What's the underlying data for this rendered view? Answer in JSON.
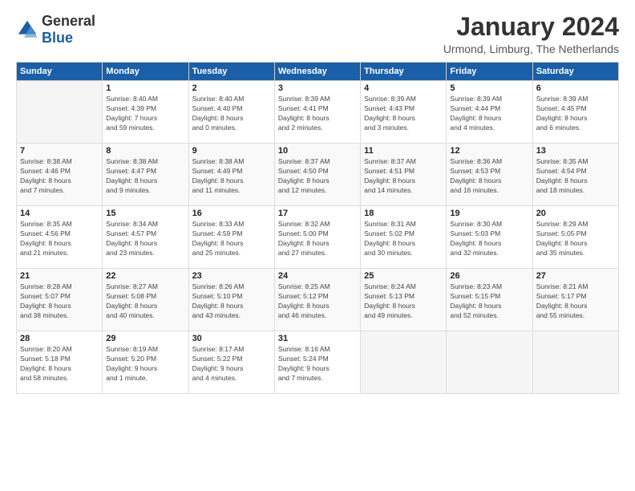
{
  "logo": {
    "general": "General",
    "blue": "Blue"
  },
  "header": {
    "title": "January 2024",
    "location": "Urmond, Limburg, The Netherlands"
  },
  "days_of_week": [
    "Sunday",
    "Monday",
    "Tuesday",
    "Wednesday",
    "Thursday",
    "Friday",
    "Saturday"
  ],
  "weeks": [
    [
      {
        "day": "",
        "info": ""
      },
      {
        "day": "1",
        "info": "Sunrise: 8:40 AM\nSunset: 4:39 PM\nDaylight: 7 hours\nand 59 minutes."
      },
      {
        "day": "2",
        "info": "Sunrise: 8:40 AM\nSunset: 4:40 PM\nDaylight: 8 hours\nand 0 minutes."
      },
      {
        "day": "3",
        "info": "Sunrise: 8:39 AM\nSunset: 4:41 PM\nDaylight: 8 hours\nand 2 minutes."
      },
      {
        "day": "4",
        "info": "Sunrise: 8:39 AM\nSunset: 4:43 PM\nDaylight: 8 hours\nand 3 minutes."
      },
      {
        "day": "5",
        "info": "Sunrise: 8:39 AM\nSunset: 4:44 PM\nDaylight: 8 hours\nand 4 minutes."
      },
      {
        "day": "6",
        "info": "Sunrise: 8:39 AM\nSunset: 4:45 PM\nDaylight: 8 hours\nand 6 minutes."
      }
    ],
    [
      {
        "day": "7",
        "info": "Sunrise: 8:38 AM\nSunset: 4:46 PM\nDaylight: 8 hours\nand 7 minutes."
      },
      {
        "day": "8",
        "info": "Sunrise: 8:38 AM\nSunset: 4:47 PM\nDaylight: 8 hours\nand 9 minutes."
      },
      {
        "day": "9",
        "info": "Sunrise: 8:38 AM\nSunset: 4:49 PM\nDaylight: 8 hours\nand 11 minutes."
      },
      {
        "day": "10",
        "info": "Sunrise: 8:37 AM\nSunset: 4:50 PM\nDaylight: 8 hours\nand 12 minutes."
      },
      {
        "day": "11",
        "info": "Sunrise: 8:37 AM\nSunset: 4:51 PM\nDaylight: 8 hours\nand 14 minutes."
      },
      {
        "day": "12",
        "info": "Sunrise: 8:36 AM\nSunset: 4:53 PM\nDaylight: 8 hours\nand 16 minutes."
      },
      {
        "day": "13",
        "info": "Sunrise: 8:35 AM\nSunset: 4:54 PM\nDaylight: 8 hours\nand 18 minutes."
      }
    ],
    [
      {
        "day": "14",
        "info": "Sunrise: 8:35 AM\nSunset: 4:56 PM\nDaylight: 8 hours\nand 21 minutes."
      },
      {
        "day": "15",
        "info": "Sunrise: 8:34 AM\nSunset: 4:57 PM\nDaylight: 8 hours\nand 23 minutes."
      },
      {
        "day": "16",
        "info": "Sunrise: 8:33 AM\nSunset: 4:59 PM\nDaylight: 8 hours\nand 25 minutes."
      },
      {
        "day": "17",
        "info": "Sunrise: 8:32 AM\nSunset: 5:00 PM\nDaylight: 8 hours\nand 27 minutes."
      },
      {
        "day": "18",
        "info": "Sunrise: 8:31 AM\nSunset: 5:02 PM\nDaylight: 8 hours\nand 30 minutes."
      },
      {
        "day": "19",
        "info": "Sunrise: 8:30 AM\nSunset: 5:03 PM\nDaylight: 8 hours\nand 32 minutes."
      },
      {
        "day": "20",
        "info": "Sunrise: 8:29 AM\nSunset: 5:05 PM\nDaylight: 8 hours\nand 35 minutes."
      }
    ],
    [
      {
        "day": "21",
        "info": "Sunrise: 8:28 AM\nSunset: 5:07 PM\nDaylight: 8 hours\nand 38 minutes."
      },
      {
        "day": "22",
        "info": "Sunrise: 8:27 AM\nSunset: 5:08 PM\nDaylight: 8 hours\nand 40 minutes."
      },
      {
        "day": "23",
        "info": "Sunrise: 8:26 AM\nSunset: 5:10 PM\nDaylight: 8 hours\nand 43 minutes."
      },
      {
        "day": "24",
        "info": "Sunrise: 8:25 AM\nSunset: 5:12 PM\nDaylight: 8 hours\nand 46 minutes."
      },
      {
        "day": "25",
        "info": "Sunrise: 8:24 AM\nSunset: 5:13 PM\nDaylight: 8 hours\nand 49 minutes."
      },
      {
        "day": "26",
        "info": "Sunrise: 8:23 AM\nSunset: 5:15 PM\nDaylight: 8 hours\nand 52 minutes."
      },
      {
        "day": "27",
        "info": "Sunrise: 8:21 AM\nSunset: 5:17 PM\nDaylight: 8 hours\nand 55 minutes."
      }
    ],
    [
      {
        "day": "28",
        "info": "Sunrise: 8:20 AM\nSunset: 5:18 PM\nDaylight: 8 hours\nand 58 minutes."
      },
      {
        "day": "29",
        "info": "Sunrise: 8:19 AM\nSunset: 5:20 PM\nDaylight: 9 hours\nand 1 minute."
      },
      {
        "day": "30",
        "info": "Sunrise: 8:17 AM\nSunset: 5:22 PM\nDaylight: 9 hours\nand 4 minutes."
      },
      {
        "day": "31",
        "info": "Sunrise: 8:16 AM\nSunset: 5:24 PM\nDaylight: 9 hours\nand 7 minutes."
      },
      {
        "day": "",
        "info": ""
      },
      {
        "day": "",
        "info": ""
      },
      {
        "day": "",
        "info": ""
      }
    ]
  ]
}
